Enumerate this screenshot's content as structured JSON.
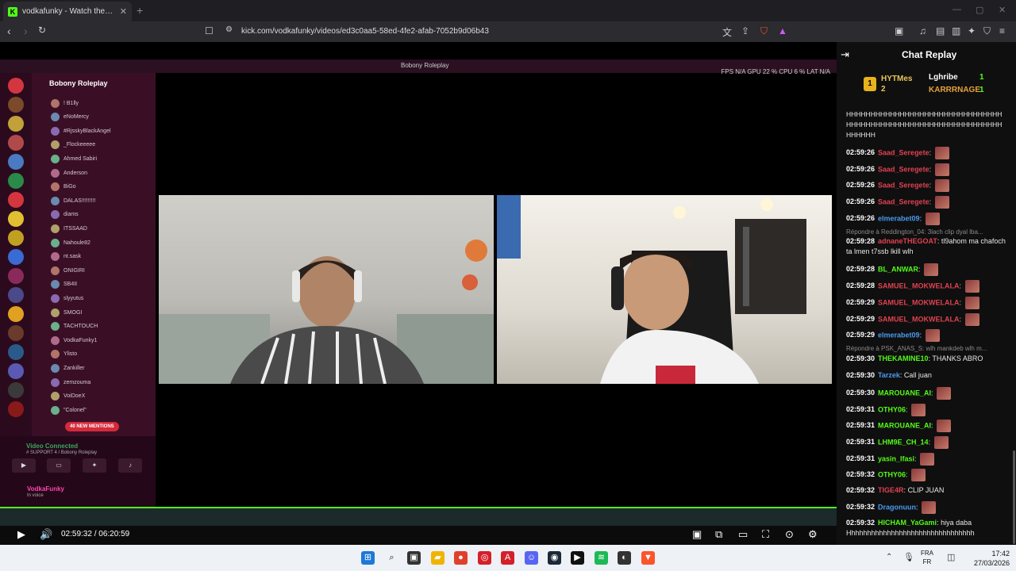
{
  "browser": {
    "tab_title": "vodkafunky - Watch the VOD on Kick",
    "url": "kick.com/vodkafunky/videos/ed3c0aa5-58ed-4fe2-afab-7052b9d06b43",
    "brand_color": "#53fc18"
  },
  "discord": {
    "window_title": "Bobony Roleplay",
    "server_name": "Bobony Roleplay",
    "stats": "FPS N/A   GPU 22 %   CPU 6 %   LAT N/A",
    "voice_users": [
      "! B1lly",
      "eNoMercy",
      "#RjsskyBlackAngel",
      "_Flockeeeee",
      "Ahmed Sabiri",
      "Anderson",
      "BiGo",
      "DALAS!!!!!!!!!",
      "diams",
      "ITSSAAD",
      "Nahoule82",
      "nt.sask",
      "ONIGIRI",
      "SB4II",
      "slyyutus",
      "SMOGI",
      "TACHTOUCH",
      "VodkaFunky1",
      "Ylisto",
      "Zankiller",
      "zemzouma",
      "VoiDoeX",
      "\"Colonel\""
    ],
    "mentions": "40 NEW MENTIONS",
    "voice_status": "Video Connected",
    "voice_channel": "# SUPPORT 4 / Bobony Roleplay",
    "me_name": "VodkaFunky",
    "me_status": "In voice"
  },
  "player": {
    "time_current": "02:59:32",
    "time_total": "06:20:59"
  },
  "chat": {
    "title": "Chat Replay",
    "leaderboard": [
      {
        "name": "HYTMes",
        "count": "2"
      },
      {
        "name": "Lghribe",
        "count": "1"
      },
      {
        "name": "KARRRNAGE",
        "count": "1"
      }
    ],
    "rank_badge": "1",
    "top_text": "HHHHHHHHHHHHHHHHHHHHHHHHHHHHHHHHHHHHHHHHHHHHHHHHHHHHHHHHHHHHHHHHHHHHHH",
    "messages": [
      {
        "ts": "02:59:26",
        "user": "Saad_Seregete",
        "color": "#e0424f",
        "text": "",
        "emote": true
      },
      {
        "ts": "02:59:26",
        "user": "Saad_Seregete",
        "color": "#e0424f",
        "text": "",
        "emote": true
      },
      {
        "ts": "02:59:26",
        "user": "Saad_Seregete",
        "color": "#e0424f",
        "text": "",
        "emote": true
      },
      {
        "ts": "02:59:26",
        "user": "Saad_Seregete",
        "color": "#e0424f",
        "text": "",
        "emote": true
      },
      {
        "ts": "02:59:26",
        "user": "elmerabet09",
        "color": "#4a9bf0",
        "text": "",
        "emote": true
      },
      {
        "ts": "02:59:28",
        "user": "adnaneTHEGOAT",
        "color": "#e0424f",
        "text": "tl9ahom ma chafoch ta lmen t7ssb lkill wlh",
        "emote": false
      },
      {
        "ts": "02:59:28",
        "user": "BL_ANWAR",
        "color": "#53fc18",
        "text": "",
        "emote": true
      },
      {
        "ts": "02:59:28",
        "user": "SAMUEL_MOKWELALA",
        "color": "#e0424f",
        "text": "",
        "emote": true
      },
      {
        "ts": "02:59:29",
        "user": "SAMUEL_MOKWELALA",
        "color": "#e0424f",
        "text": "",
        "emote": true
      },
      {
        "ts": "02:59:29",
        "user": "SAMUEL_MOKWELALA",
        "color": "#e0424f",
        "text": "",
        "emote": true
      },
      {
        "ts": "02:59:29",
        "user": "elmerabet09",
        "color": "#4a9bf0",
        "text": "",
        "emote": true
      },
      {
        "ts": "02:59:30",
        "user": "THEKAMINE10",
        "color": "#53fc18",
        "text": "THANKS ABRO",
        "emote": false
      },
      {
        "ts": "02:59:30",
        "user": "Tarzek",
        "color": "#4a9bf0",
        "text": "Call juan",
        "emote": false
      },
      {
        "ts": "02:59:30",
        "user": "MAROUANE_AI",
        "color": "#53fc18",
        "text": "",
        "emote": true
      },
      {
        "ts": "02:59:31",
        "user": "OTHY06",
        "color": "#53fc18",
        "text": "",
        "emote": true
      },
      {
        "ts": "02:59:31",
        "user": "MAROUANE_AI",
        "color": "#53fc18",
        "text": "",
        "emote": true
      },
      {
        "ts": "02:59:31",
        "user": "LHM9E_CH_14",
        "color": "#53fc18",
        "text": "",
        "emote": true
      },
      {
        "ts": "02:59:31",
        "user": "yasin_lfasi",
        "color": "#53fc18",
        "text": "",
        "emote": true
      },
      {
        "ts": "02:59:32",
        "user": "OTHY06",
        "color": "#53fc18",
        "text": "",
        "emote": true
      },
      {
        "ts": "02:59:32",
        "user": "TIGE4R",
        "color": "#e0424f",
        "text": "CLIP JUAN",
        "emote": false
      },
      {
        "ts": "02:59:32",
        "user": "Dragonuun",
        "color": "#4a9bf0",
        "text": "",
        "emote": true
      },
      {
        "ts": "02:59:32",
        "user": "HICHAM_YaGami",
        "color": "#53fc18",
        "text": "hiya daba Hhhhhhhhhhhhhhhhhhhhhhhhhhhhhhhh",
        "emote": false
      }
    ],
    "replies": [
      "Répondre à Reddington_04: 3lach clip dyal lba...",
      "Répondre à PSK_ANAS_S: wlh mankdeb wlh m..."
    ]
  },
  "windows": {
    "lang1": "FRA",
    "lang2": "FR",
    "time": "17:42",
    "date": "27/03/2026"
  }
}
